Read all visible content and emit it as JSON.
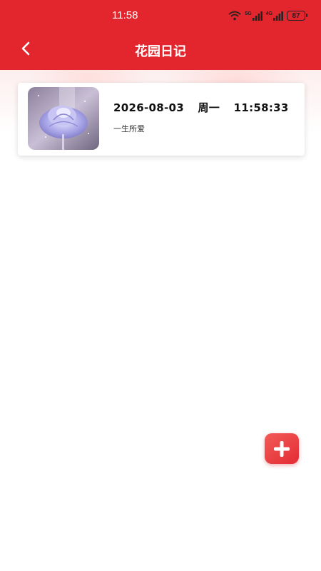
{
  "status_bar": {
    "time": "11:58",
    "network_5g": "5G",
    "network_4g": "4G",
    "battery": "87"
  },
  "header": {
    "title": "花园日记",
    "back_icon": "chevron-left-icon",
    "color": "#e3262d"
  },
  "entries": [
    {
      "date": "2026-08-03",
      "weekday": "周一",
      "time": "11:58:33",
      "text": "一生所爱",
      "image": "purple-rose-photo"
    }
  ],
  "fab": {
    "icon": "plus-icon",
    "color": "#e83038"
  }
}
